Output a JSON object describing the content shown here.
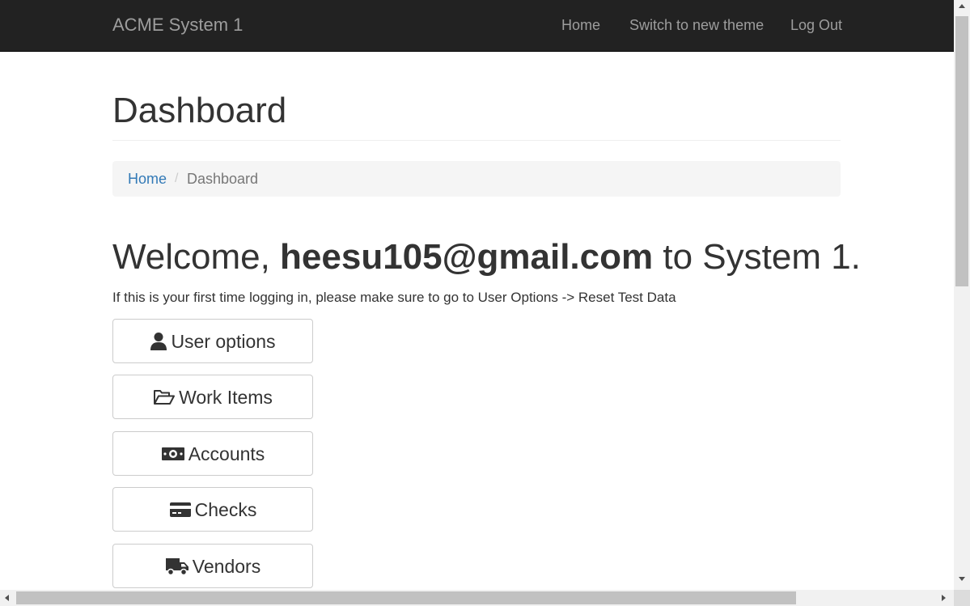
{
  "navbar": {
    "brand": "ACME System 1",
    "links": [
      {
        "label": "Home"
      },
      {
        "label": "Switch to new theme"
      },
      {
        "label": "Log Out"
      }
    ]
  },
  "page": {
    "title": "Dashboard"
  },
  "breadcrumb": {
    "home": "Home",
    "separator": "/",
    "current": "Dashboard"
  },
  "welcome": {
    "prefix": "Welcome, ",
    "user": "heesu105@gmail.com",
    "suffix": " to System 1."
  },
  "notice": "If this is your first time logging in, please make sure to go to User Options -> Reset Test Data",
  "menu": [
    {
      "label": "User options",
      "icon": "user-icon"
    },
    {
      "label": "Work Items",
      "icon": "folder-open-icon"
    },
    {
      "label": "Accounts",
      "icon": "money-icon"
    },
    {
      "label": "Checks",
      "icon": "credit-card-icon"
    },
    {
      "label": "Vendors",
      "icon": "truck-icon"
    }
  ],
  "colors": {
    "navbar_bg": "#222222",
    "navbar_text": "#9d9d9d",
    "link": "#337ab7",
    "text": "#333333",
    "breadcrumb_bg": "#f5f5f5"
  }
}
